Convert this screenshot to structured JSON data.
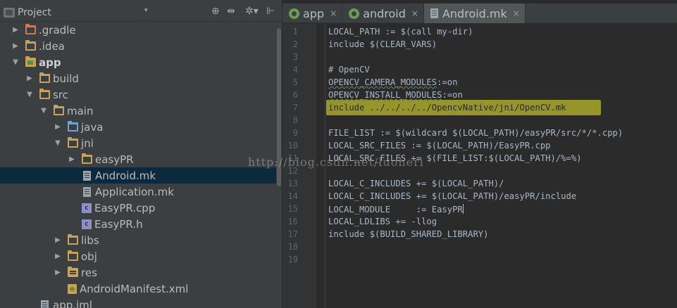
{
  "project_panel": {
    "title": "Project",
    "dropdown_glyph": "▾",
    "tools": [
      "⊕",
      "⇹",
      "✲▾",
      "⊩"
    ],
    "tree": [
      {
        "label": "gradle_dir",
        "text": ".gradle",
        "icon": "folder-red-icon",
        "arrow": "▶",
        "depth": 0
      },
      {
        "label": "idea_dir",
        "text": ".idea",
        "icon": "folder-icon",
        "arrow": "▶",
        "depth": 0
      },
      {
        "label": "app",
        "text": "app",
        "icon": "module-folder-icon",
        "arrow": "▼",
        "depth": 0,
        "bold": true
      },
      {
        "label": "build",
        "text": "build",
        "icon": "folder-icon",
        "arrow": "▶",
        "depth": 1
      },
      {
        "label": "src",
        "text": "src",
        "icon": "folder-icon",
        "arrow": "▼",
        "depth": 1
      },
      {
        "label": "main",
        "text": "main",
        "icon": "folder-icon",
        "arrow": "▼",
        "depth": 2
      },
      {
        "label": "java",
        "text": "java",
        "icon": "folder-blue-icon",
        "arrow": "▶",
        "depth": 3
      },
      {
        "label": "jni",
        "text": "jni",
        "icon": "folder-icon",
        "arrow": "▼",
        "depth": 3
      },
      {
        "label": "easypr",
        "text": "easyPR",
        "icon": "folder-icon",
        "arrow": "▶",
        "depth": 4
      },
      {
        "label": "android-mk",
        "text": "Android.mk",
        "icon": "file-icon",
        "arrow": "",
        "depth": 4,
        "selected": true
      },
      {
        "label": "application-mk",
        "text": "Application.mk",
        "icon": "file-icon",
        "arrow": "",
        "depth": 4
      },
      {
        "label": "easypr-cpp",
        "text": "EasyPR.cpp",
        "icon": "cpp-file-icon",
        "arrow": "",
        "depth": 4
      },
      {
        "label": "easypr-h",
        "text": "EasyPR.h",
        "icon": "h-file-icon",
        "arrow": "",
        "depth": 4
      },
      {
        "label": "libs",
        "text": "libs",
        "icon": "folder-icon",
        "arrow": "▶",
        "depth": 3
      },
      {
        "label": "obj",
        "text": "obj",
        "icon": "folder-icon",
        "arrow": "▶",
        "depth": 3
      },
      {
        "label": "res",
        "text": "res",
        "icon": "res-folder-icon",
        "arrow": "▶",
        "depth": 3
      },
      {
        "label": "manifest",
        "text": "AndroidManifest.xml",
        "icon": "xml-file-icon",
        "arrow": "",
        "depth": 3
      },
      {
        "label": "app-iml",
        "text": "app.iml",
        "icon": "file-icon",
        "arrow": "",
        "depth": 1
      }
    ]
  },
  "tabs": [
    {
      "label": "app",
      "icon": "android-module-icon",
      "active": false
    },
    {
      "label": "android",
      "icon": "android-module-icon",
      "active": false
    },
    {
      "label": "Android.mk",
      "icon": "file-icon",
      "active": true
    }
  ],
  "tab_close_glyph": "×",
  "editor": {
    "lines": [
      "LOCAL_PATH := $(call my-dir)",
      "include $(CLEAR_VARS)",
      "",
      "# OpenCV",
      "OPENCV_CAMERA_MODULES:=on",
      "OPENCV_INSTALL_MODULES:=on",
      "include ../../../../OpencvNative/jni/OpenCV.mk",
      "",
      "FILE_LIST := $(wildcard $(LOCAL_PATH)/easyPR/src/*/*.cpp)",
      "LOCAL_SRC_FILES := $(LOCAL_PATH)/EasyPR.cpp",
      "LOCAL_SRC_FILES += $(FILE_LIST:$(LOCAL_PATH)/%=%)",
      "",
      "LOCAL_C_INCLUDES += $(LOCAL_PATH)/",
      "LOCAL_C_INCLUDES += $(LOCAL_PATH)/easyPR/include",
      "LOCAL_MODULE     := EasyPR",
      "LOCAL_LDLIBS += -llog",
      "include $(BUILD_SHARED_LIBRARY)",
      "",
      ""
    ],
    "highlight_line": 7,
    "highlight_color": "#a8a82a"
  },
  "watermark": "http://blog.csdn.net/luoheri"
}
